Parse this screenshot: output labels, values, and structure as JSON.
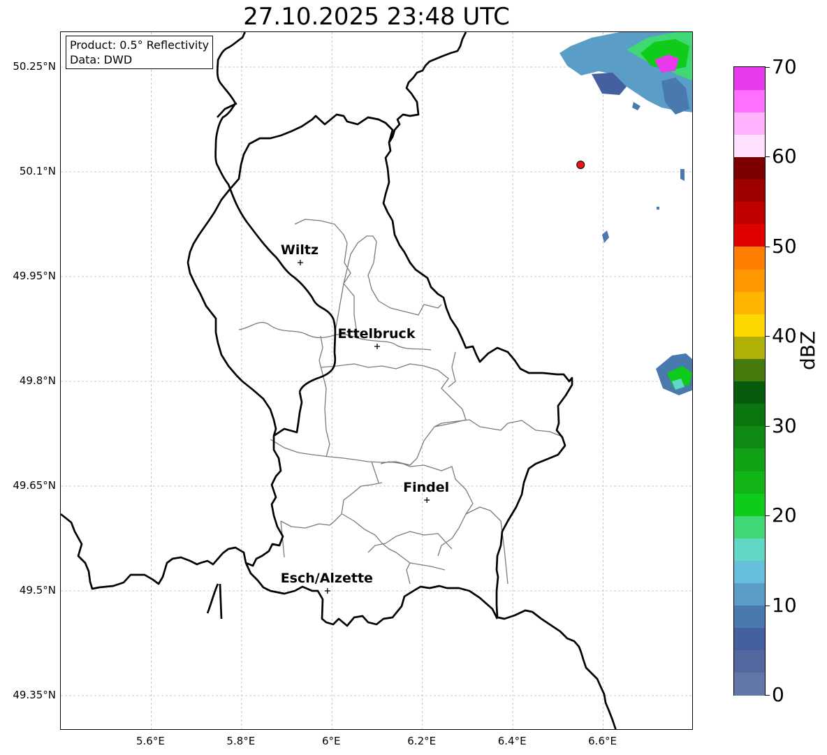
{
  "title": "27.10.2025 23:48 UTC",
  "info": {
    "product": "Product: 0.5° Reflectivity",
    "source": "Data: DWD"
  },
  "lat_labels": [
    "50.25°N",
    "50.1°N",
    "49.95°N",
    "49.8°N",
    "49.65°N",
    "49.5°N",
    "49.35°N"
  ],
  "lon_labels": [
    "5.6°E",
    "5.8°E",
    "6°E",
    "6.2°E",
    "6.4°E",
    "6.6°E"
  ],
  "cities": [
    {
      "name": "Wiltz",
      "lon": 5.93,
      "lat": 49.97
    },
    {
      "name": "Ettelbruck",
      "lon": 6.1,
      "lat": 49.85
    },
    {
      "name": "Findel",
      "lon": 6.21,
      "lat": 49.63
    },
    {
      "name": "Esch/Alzette",
      "lon": 5.99,
      "lat": 49.5
    }
  ],
  "radar_site": {
    "lon": 6.55,
    "lat": 50.11,
    "color": "#e8160f"
  },
  "map_extent": {
    "lon_min": 5.4,
    "lon_max": 6.8,
    "lat_min": 49.3,
    "lat_max": 50.3
  },
  "colorbar": {
    "unit": "dBZ",
    "min": 0,
    "max": 70,
    "tick_labels": [
      "0",
      "10",
      "20",
      "30",
      "40",
      "50",
      "60",
      "70"
    ],
    "colors": [
      "#6376a8",
      "#53689f",
      "#4560a1",
      "#4a79ae",
      "#5a9ec8",
      "#66c0db",
      "#60d8c5",
      "#3fd874",
      "#10cc1a",
      "#11b515",
      "#11a114",
      "#0f8a12",
      "#0b7610",
      "#075c0b",
      "#477a0c",
      "#afb106",
      "#ffd700",
      "#ffb400",
      "#ff9800",
      "#ff7d00",
      "#e00000",
      "#c00000",
      "#9e0000",
      "#7c0000",
      "#ffe1ff",
      "#ffb3ff",
      "#ff70ff",
      "#e939ec"
    ]
  }
}
